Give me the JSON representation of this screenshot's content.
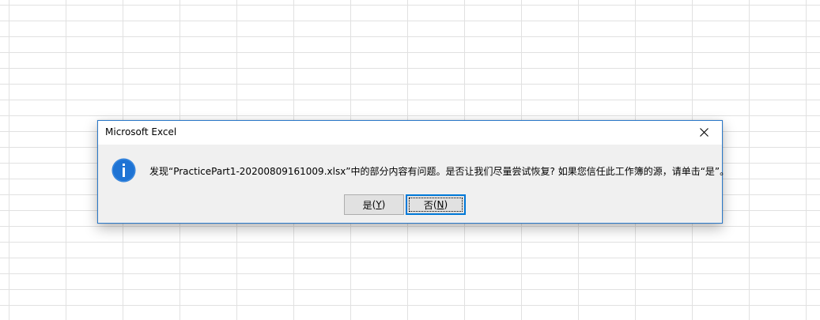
{
  "dialog": {
    "title": "Microsoft Excel",
    "icon": "info-icon",
    "message": "发现“PracticePart1-20200809161009.xlsx”中的部分内容有问题。是否让我们尽量尝试恢复? 如果您信任此工作簿的源，请单击“是”。",
    "buttons": {
      "yes": {
        "label": "是",
        "open": "(",
        "key": "Y",
        "close": ")"
      },
      "no": {
        "label": "否",
        "open": "(",
        "key": "N",
        "close": ")"
      }
    },
    "default_button": "no"
  },
  "colors": {
    "accent": "#0078d7",
    "dialog_border": "#2b79c9",
    "info_icon": "#1e73d4",
    "grid_line": "#e1e1e1"
  }
}
